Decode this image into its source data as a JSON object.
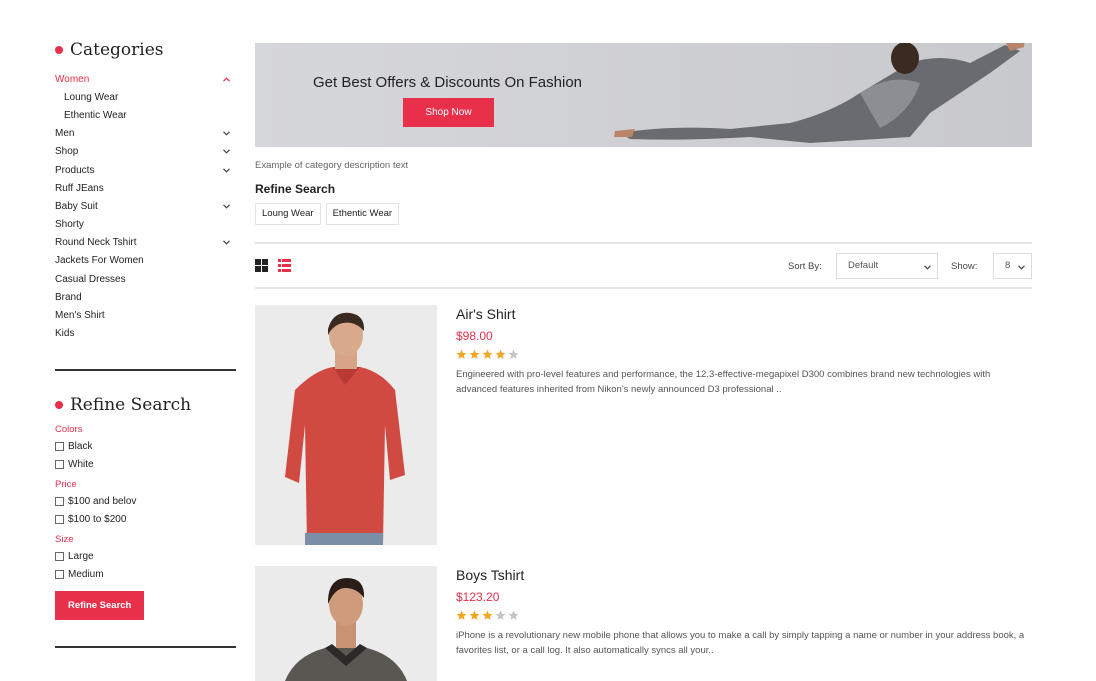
{
  "sidebar": {
    "categories_heading": "Categories",
    "categories": [
      {
        "label": "Women",
        "active": true,
        "sub": false,
        "chevron": "up"
      },
      {
        "label": "Loung Wear",
        "active": false,
        "sub": true,
        "chevron": ""
      },
      {
        "label": "Ethentic Wear",
        "active": false,
        "sub": true,
        "chevron": ""
      },
      {
        "label": "Men",
        "active": false,
        "sub": false,
        "chevron": "down"
      },
      {
        "label": "Shop",
        "active": false,
        "sub": false,
        "chevron": "down"
      },
      {
        "label": "Products",
        "active": false,
        "sub": false,
        "chevron": "down"
      },
      {
        "label": "Ruff JEans",
        "active": false,
        "sub": false,
        "chevron": ""
      },
      {
        "label": "Baby Suit",
        "active": false,
        "sub": false,
        "chevron": "down"
      },
      {
        "label": "Shorty",
        "active": false,
        "sub": false,
        "chevron": ""
      },
      {
        "label": "Round Neck Tshirt",
        "active": false,
        "sub": false,
        "chevron": "down"
      },
      {
        "label": "Jackets For Women",
        "active": false,
        "sub": false,
        "chevron": ""
      },
      {
        "label": "Casual Dresses",
        "active": false,
        "sub": false,
        "chevron": ""
      },
      {
        "label": "Brand",
        "active": false,
        "sub": false,
        "chevron": ""
      },
      {
        "label": "Men's Shirt",
        "active": false,
        "sub": false,
        "chevron": ""
      },
      {
        "label": "Kids",
        "active": false,
        "sub": false,
        "chevron": ""
      }
    ],
    "refine_heading": "Refine Search",
    "filters": [
      {
        "label": "Colors",
        "options": [
          "Black",
          "White"
        ]
      },
      {
        "label": "Price",
        "options": [
          "$100 and belov",
          "$100 to $200"
        ]
      },
      {
        "label": "Size",
        "options": [
          "Large",
          "Medium"
        ]
      }
    ],
    "refine_button": "Refine Search"
  },
  "banner": {
    "title": "Get Best Offers & Discounts On Fashion",
    "button": "Shop Now"
  },
  "category_description": "Example of category description text",
  "refine": {
    "title": "Refine Search",
    "tags": [
      "Loung Wear",
      "Ethentic Wear"
    ]
  },
  "toolbar": {
    "sort_label": "Sort By:",
    "sort_value": "Default",
    "show_label": "Show:",
    "show_value": "8"
  },
  "products": [
    {
      "name": "Air's Shirt",
      "price": "$98.00",
      "rating": 4,
      "max_rating": 5,
      "description": "Engineered with pro-level features and performance, the 12.3-effective-megapixel D300 combines brand new technologies with advanced features inherited from Nikon's newly announced D3 professional .."
    },
    {
      "name": "Boys Tshirt",
      "price": "$123.20",
      "rating": 3,
      "max_rating": 5,
      "description": "iPhone is a revolutionary new mobile phone that allows you to make a call by simply tapping a name or number in your address book, a favorites list, or a call log. It also automatically syncs all your.."
    }
  ],
  "colors": {
    "accent": "#e8304b",
    "star": "#f5a623",
    "star_empty": "#c4c4c4"
  }
}
